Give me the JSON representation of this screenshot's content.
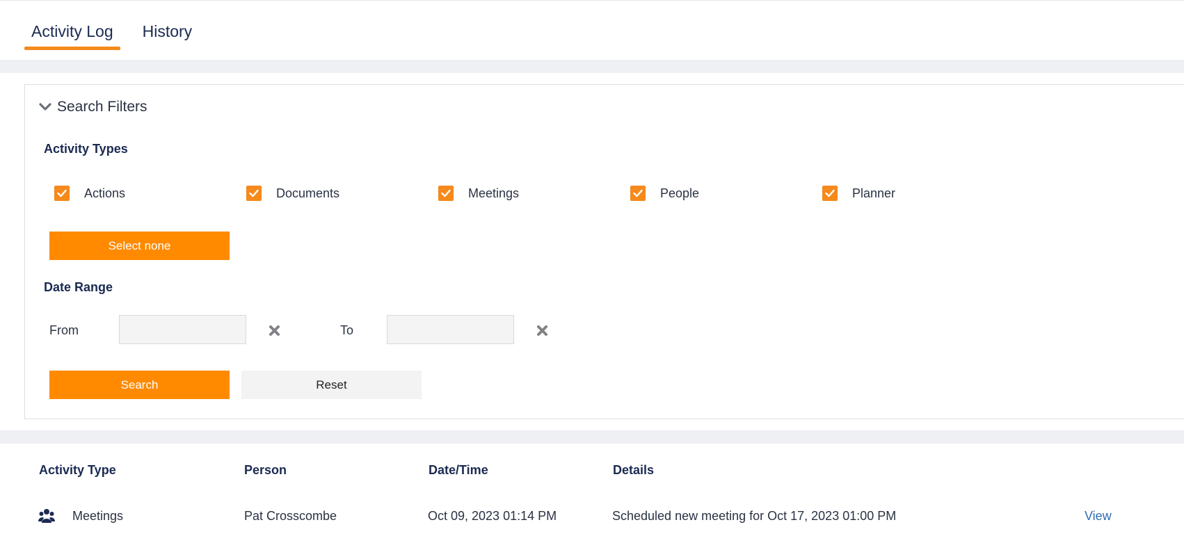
{
  "tabs": [
    {
      "label": "Activity Log",
      "active": true
    },
    {
      "label": "History",
      "active": false
    }
  ],
  "filters": {
    "title": "Search Filters",
    "activity_types_label": "Activity Types",
    "checkboxes": [
      {
        "label": "Actions",
        "checked": true
      },
      {
        "label": "Documents",
        "checked": true
      },
      {
        "label": "Meetings",
        "checked": true
      },
      {
        "label": "People",
        "checked": true
      },
      {
        "label": "Planner",
        "checked": true
      }
    ],
    "select_none_label": "Select none",
    "date_range_label": "Date Range",
    "from_label": "From",
    "from_value": "",
    "to_label": "To",
    "to_value": "",
    "search_label": "Search",
    "reset_label": "Reset"
  },
  "table": {
    "headers": [
      "Activity Type",
      "Person",
      "Date/Time",
      "Details"
    ],
    "rows": [
      {
        "icon": "people-icon",
        "activity_type": "Meetings",
        "person": "Pat Crosscombe",
        "datetime": "Oct 09, 2023 01:14 PM",
        "details": "Scheduled new meeting for Oct 17, 2023 01:00 PM",
        "action": "View"
      }
    ]
  },
  "colors": {
    "accent": "#ff8a00",
    "heading": "#1b2a52",
    "link": "#2f6db3"
  }
}
